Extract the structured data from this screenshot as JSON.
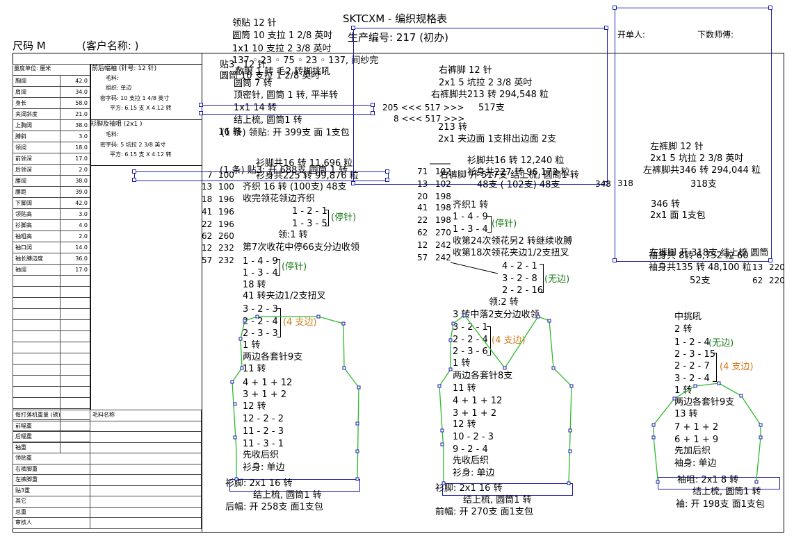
{
  "title": "SKTCXM - 编织规格表",
  "header": {
    "size": "尺码 M",
    "customer": "(客户名称:              )",
    "production_no": "生产编号: 217 (初办)",
    "issuer": "开单人:",
    "master": "下数师傅:"
  },
  "measure": {
    "unit": "量度单位: 厘米",
    "rows": [
      [
        "胸阔",
        "42.0"
      ],
      [
        "肩阔",
        "34.0"
      ],
      [
        "身长",
        "58.0"
      ],
      [
        "夹阔斜度",
        "21.0"
      ],
      [
        "上胸阔",
        "38.0"
      ],
      [
        "膊斜",
        "3.0"
      ],
      [
        "领阔",
        "18.0"
      ],
      [
        "前领深",
        "17.0"
      ],
      [
        "后领深",
        "2.0"
      ],
      [
        "腰阔",
        "38.0"
      ],
      [
        "腰距",
        "39.0"
      ],
      [
        "下脚阔",
        "42.0"
      ],
      [
        "领贴高",
        "3.0"
      ],
      [
        "衫脚高",
        "4.0"
      ],
      [
        "袖咀高",
        "2.0"
      ],
      [
        "袖口阔",
        "14.0"
      ],
      [
        "袖长膊边度",
        "36.0"
      ],
      [
        "袖阔",
        "17.0"
      ]
    ]
  },
  "spec": {
    "front_back": {
      "title": "前后幅袖 (针号: 12 针)",
      "yarn": "毛料:",
      "tissue": "组织: 单边",
      "density": "密字码: 10 支拉 1 4/8 英寸",
      "square": "平方: 6.15 支 X 4.12 转"
    },
    "hem": {
      "title": "衫脚及袖咀 (2x1 )",
      "yarn": "毛料:",
      "density": "密字码: 5 坑拉 2 3/8 英寸",
      "square": "平方: 6.15 支 X 4.12 转"
    }
  },
  "weight": {
    "header": [
      "每打落机重量 (磅)",
      "毛料名称"
    ],
    "rows": [
      "前幅重",
      "后幅重",
      "袖重",
      "领贴重",
      "右裤脚重",
      "左裤脚重",
      "贴3重",
      "其它",
      "总重",
      "审核人"
    ]
  },
  "collar": {
    "l1": "领贴  12 针",
    "l2": "圆筒 10 支拉 1 2/8 英吋",
    "l3": "1x1   10 支拉 2 3/8 英吋",
    "l4": "137 ◦ 23 ◦ 75 ◦ 23 ◦ 137, 间纱完",
    "l5a": "贴3 , 12 针",
    "l5b": "圆筒  10 支拉 1 2/8 英吋",
    "l5c": "敝眼 1 转    毛2 转脚挑吼",
    "l6": "圆筒      7 转",
    "l7": "顶密针, 圆筒 1 转, 平半转",
    "l8": "1x1       14 转",
    "l9": "结上梳, 圆筒1 转",
    "l10": "(1 条) 领贴: 开 399支 面 1支包",
    "l10b": "16 转"
  },
  "right_leg": {
    "l1": "右裤脚  12 针",
    "l2": "2x1   5 坑拉 2 3/8 英吋",
    "l3": "右裤脚共213 转 294,548 粒",
    "l4": "205 <<< 517 >>>",
    "l4b": "517支",
    "l5": "8 <<< 517 >>>",
    "l6": "213 转",
    "l7": "2x1       夹边面 1支排出边面 2支"
  },
  "left_leg": {
    "l1": "左裤脚  12 针",
    "l2": "2x1   5 坑拉 2 3/8 英吋",
    "l3": "左裤脚共346 转 294,044 粒",
    "l4": "318支",
    "l5": "346 转",
    "l6": "2x1         面 1支包",
    "l7": "318"
  },
  "sleeve_top": {
    "l1": "左裤脚 开 318支  结上梳 圆筒",
    "l2": "袖身共135 转 48,100 粒",
    "l3": "52支",
    "l4a": "13",
    "l4b": "220",
    "l5a": "62",
    "l5b": "220",
    "l6": "袖身共 8转 6,752 粒  60"
  },
  "back": {
    "mid1": "衫脚共16 转 11,696 粒",
    "mid2": "(1 条) 贴3: 开 688支 圆筒 1 转",
    "mid3": "衫身共225 转 99,876 粒",
    "rows": [
      [
        "7",
        "100"
      ],
      [
        "13",
        "100"
      ],
      [
        "18",
        "196"
      ],
      [
        "41",
        "196"
      ],
      [
        "22",
        "196"
      ],
      [
        "62",
        "260"
      ],
      [
        "12",
        "232"
      ],
      [
        "57",
        "232"
      ]
    ],
    "steps": [
      "齐织 16 转 (100支) 48支",
      "收完领花领边齐织",
      "1 - 2 - 1",
      "1 - 3 - 5",
      "领:1 转",
      "第7次收花中停66支分边收领",
      "1 - 4 - 9",
      "1 - 3 - 4",
      "18 转",
      "41 转夹边1/2支扭叉",
      "3 - 2 - 3",
      "2 - 2 - 4",
      "2 - 3 - 3",
      "1 转",
      "两边各套针9支",
      "11 转",
      "4 + 1 + 12",
      "3 + 1 + 2",
      "12 转",
      "12 - 2 - 2",
      "11 - 2 - 3",
      "11 - 3 - 1",
      "先收后织",
      "衫身: 单边",
      "衫脚: 2x1    16 转",
      "结上梳, 圆筒1 转",
      "后幅: 开 258支 面1支包"
    ],
    "stop": "(停针)",
    "stop2": "(停针)",
    "edge": "(4 支边)"
  },
  "front": {
    "mid1": "衫脚共16 转 12,240 粒",
    "mid2": "衫身共227 转 96,172 粒",
    "mid3": "右裤脚 开 517支  结上梳, 圆筒1 转",
    "mid4": "348",
    "rows": [
      [
        "71",
        "102"
      ],
      [
        "13",
        "102"
      ],
      [
        "20",
        "198"
      ],
      [
        "41",
        "198"
      ],
      [
        "22",
        "198"
      ],
      [
        "62",
        "270"
      ],
      [
        "12",
        "242"
      ],
      [
        "57",
        "242"
      ]
    ],
    "steps": [
      "48支 ( 102支) 48支",
      "齐织1 转",
      "1 - 4 - 9",
      "1 - 3 - 4",
      "收第24次领花另2 转继续收膊",
      "收第18次领花夹边1/2支扭叉",
      "4 - 2 - 1",
      "3 - 2 - 8",
      "2 - 2 - 16",
      "领:2 转",
      "3 转中落2支分边收领",
      "3 - 2 - 1",
      "2 - 2 - 4",
      "2 - 3 - 6",
      "1 转",
      "两边各套针8支",
      "11 转",
      "4 + 1 + 12",
      "3 + 1 + 2",
      "12 转",
      "10 - 2 - 3",
      "9 - 2 - 4",
      "先收后织",
      "衫身: 单边",
      "衫脚:  2x1    16 转",
      "结上梳, 圆筒1 转",
      "前幅: 开 270支 面1支包"
    ],
    "stop": "(停针)",
    "noedge": "(无边)",
    "edge": "(4 支边)"
  },
  "sleeve": {
    "steps": [
      "中挑吼",
      "2 转",
      "1 - 2 - 4",
      "2 - 3 - 15",
      "2 - 2 - 7",
      "3 - 2 - 4",
      "1 转",
      "两边各套针9支",
      "13 转",
      "7 + 1 + 2",
      "6 + 1 + 9",
      "先加后织",
      "袖身: 单边",
      "袖咀: 2x1    8 转",
      "结上梳, 圆筒1 转",
      "袖: 开 198支 面1支包"
    ],
    "noedge": "(无边)",
    "edge": "(4 支边)"
  }
}
